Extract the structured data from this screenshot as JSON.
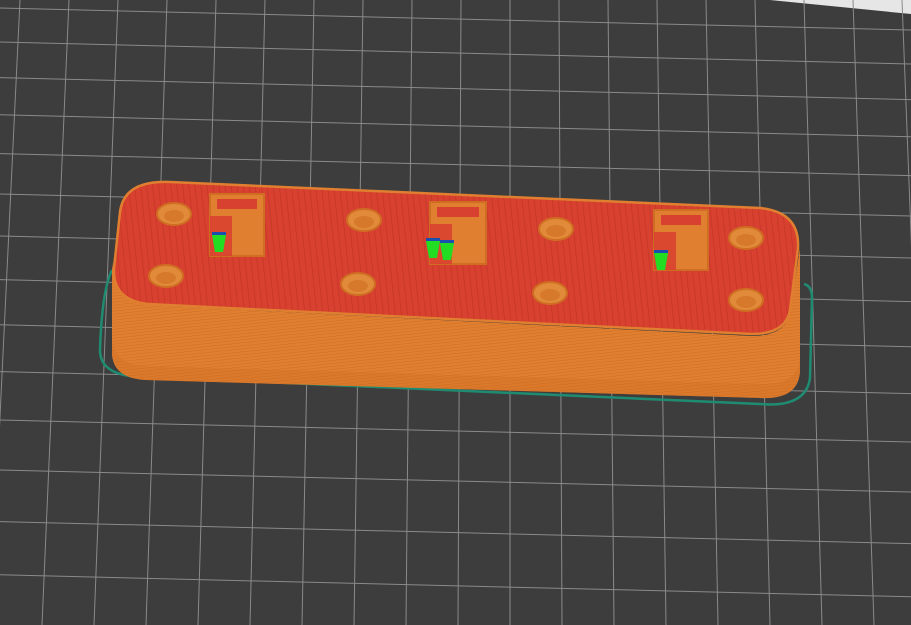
{
  "viewport": {
    "background_color": "#3d3d3d",
    "top_edge_color": "#e6e6e6"
  },
  "build_plate": {
    "grid_line_color": "#8a8a8a",
    "grid_visible": true
  },
  "preview": {
    "skirt_color": "#1f8c72",
    "wall_color": "#e07f30",
    "wall_shade_color": "#cf6e22",
    "top_surface_color": "#d8402f",
    "top_surface_line_color": "#c23526",
    "hole_color": "#e08a3a",
    "pocket_color": "#e07f30",
    "support_color": "#22dd22",
    "support_shadow_color": "#1a4fb0"
  }
}
